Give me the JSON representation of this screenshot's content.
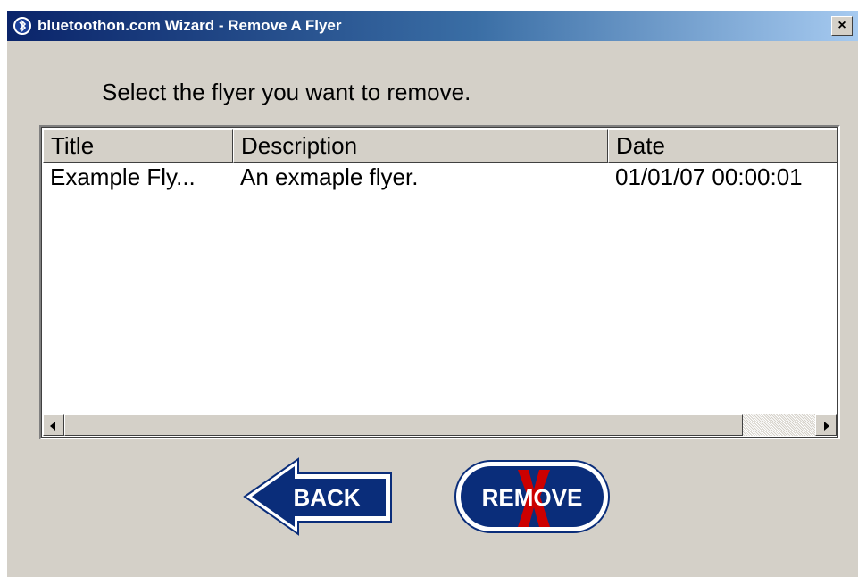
{
  "window": {
    "title": "bluetoothon.com Wizard - Remove A Flyer",
    "close_label": "×"
  },
  "main": {
    "instruction": "Select the flyer you want to remove."
  },
  "list": {
    "columns": [
      "Title",
      "Description",
      "Date"
    ],
    "rows": [
      {
        "title": "Example Fly...",
        "description": "An exmaple flyer.",
        "date": "01/01/07 00:00:01"
      }
    ]
  },
  "buttons": {
    "back_label": "BACK",
    "remove_label": "REMOVE"
  },
  "colors": {
    "title_bar_start": "#0a246a",
    "window_bg": "#d4d0c8",
    "button_fill": "#0a2d7a",
    "remove_x": "#cc0000"
  },
  "icons": {
    "title_icon": "bluetooth-logo-icon",
    "scroll_left": "arrow-left-icon",
    "scroll_right": "arrow-right-icon"
  }
}
